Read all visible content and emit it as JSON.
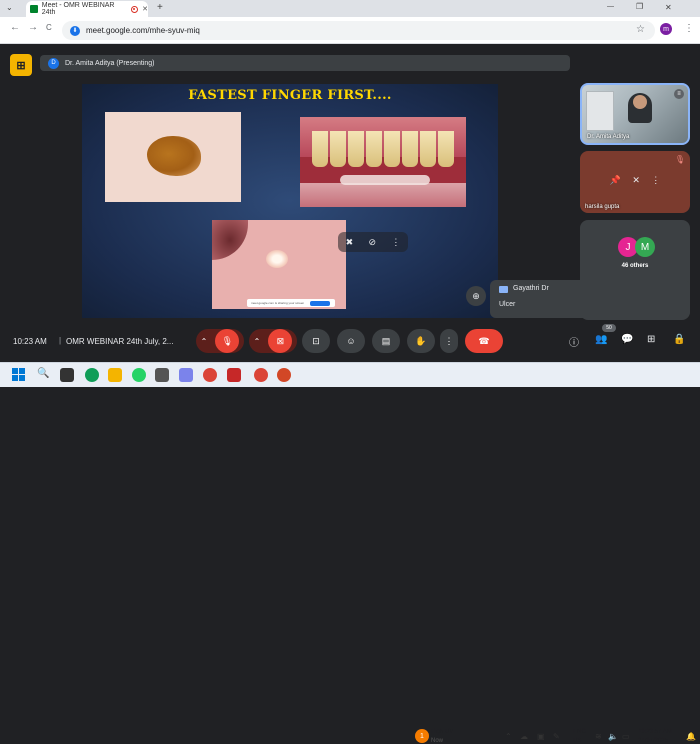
{
  "browser": {
    "tab_title": "Meet - OMR WEBINAR 24th",
    "url": "meet.google.com/mhe-syuv-miq",
    "profile_initial": "m",
    "new_tab": "+",
    "back": "←",
    "forward": "→",
    "reload": "C",
    "star": "☆",
    "menu": "⋮",
    "minimize": "—",
    "restore": "❐",
    "close": "✕"
  },
  "meet": {
    "presenter_initial": "D",
    "presenter_label": "Dr. Amita Aditya (Presenting)",
    "slide_title": "FASTEST FINGER FIRST....",
    "mini_bar_text": "meet.google.com is sharing your screen",
    "mini_bar_button": "Stop sharing"
  },
  "tiles": [
    {
      "name": "Dr. Amita Aditya"
    },
    {
      "name": "harsila gupta"
    },
    {
      "label": "46 others",
      "avatars": [
        "J",
        "M"
      ],
      "avatar_colors": [
        "#e52592",
        "#34a853"
      ]
    }
  ],
  "chat": {
    "sender": "Gayathri Dr",
    "message": "Ulcer"
  },
  "bottom": {
    "time": "10:23 AM",
    "separator": "|",
    "meeting_title": "OMR WEBINAR 24th July, 2...",
    "participants_badge": "50"
  },
  "taskbar": {
    "weather_temp": "1",
    "weather_main": "High UV",
    "weather_sub": "Now",
    "lang1": "ENG",
    "lang2": "US",
    "clock_time": "10:23:57 AM",
    "clock_date": "24/07/2025"
  },
  "colors": {
    "accent": "#ea4335",
    "meet_bg": "#202124",
    "slide_title": "#ffd700",
    "tile_border": "#8ab4f8"
  }
}
